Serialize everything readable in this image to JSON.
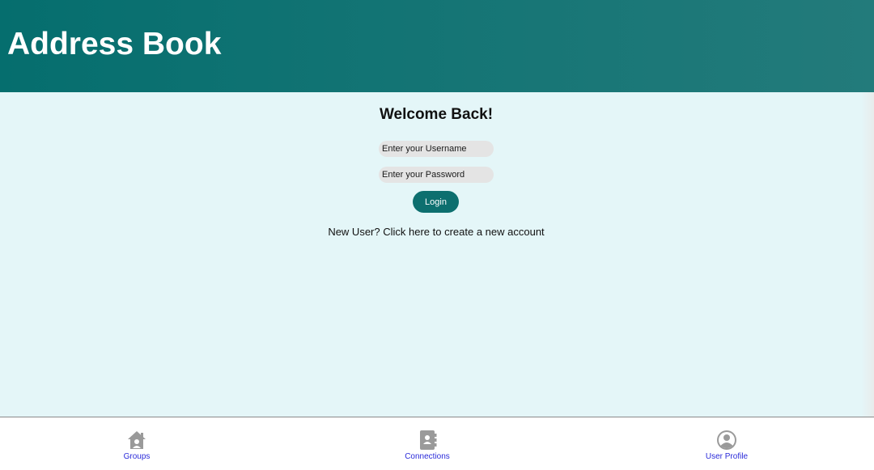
{
  "header": {
    "title": "Address Book"
  },
  "login": {
    "heading": "Welcome Back!",
    "username_placeholder": "Enter your Username",
    "username_value": "",
    "password_placeholder": "Enter your Password",
    "password_value": "",
    "button_label": "Login",
    "new_user_text": "New User? Click here to create a new account"
  },
  "tabbar": {
    "items": [
      {
        "label": "Groups",
        "icon": "house-icon"
      },
      {
        "label": "Connections",
        "icon": "contacts-book-icon"
      },
      {
        "label": "User Profile",
        "icon": "user-circle-icon"
      }
    ]
  },
  "colors": {
    "header_start": "#056e6e",
    "header_end": "#237b7b",
    "background": "#e4f6f8",
    "button": "#0d6f6f",
    "tab_label": "#2a2ad9",
    "icon": "#9a9a9a"
  }
}
